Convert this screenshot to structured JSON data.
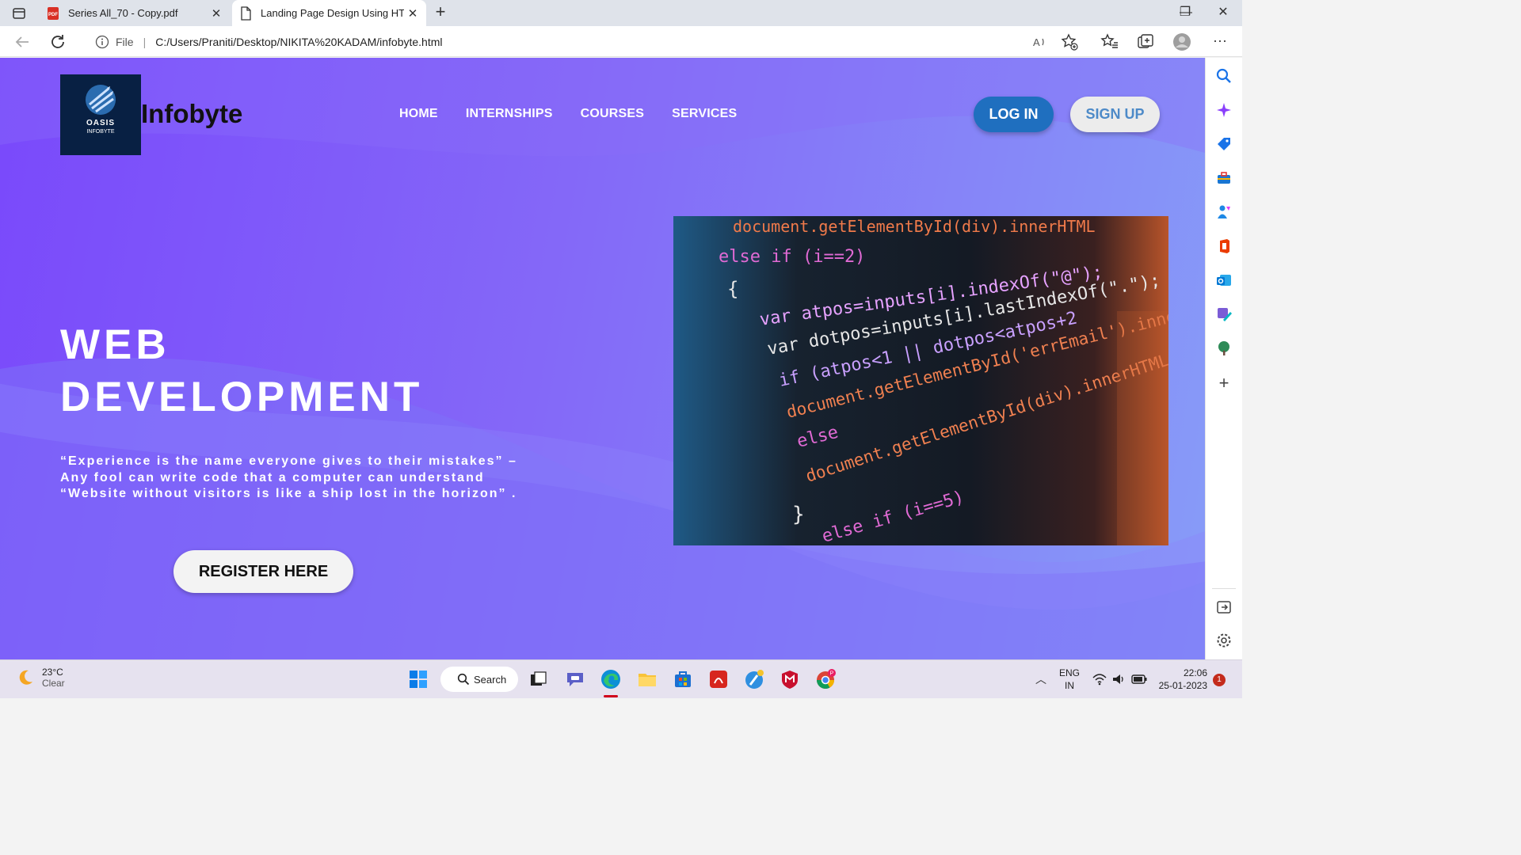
{
  "browser": {
    "tabs": [
      {
        "title": "Series All_70 - Copy.pdf",
        "icon": "pdf-icon",
        "active": false
      },
      {
        "title": "Landing Page Design Using HTM",
        "icon": "page-icon",
        "active": true
      }
    ],
    "address": {
      "scheme_label": "File",
      "url": "C:/Users/Praniti/Desktop/NIKITA%20KADAM/infobyte.html"
    }
  },
  "site": {
    "logo": {
      "line1": "OASIS",
      "line2": "INFOBYTE"
    },
    "brand": "Infobyte",
    "nav": [
      "HOME",
      "INTERNSHIPS",
      "COURSES",
      "SERVICES"
    ],
    "login_label": "LOG IN",
    "signup_label": "SIGN UP",
    "hero": {
      "title_line1": "WEB",
      "title_line2": "DEVELOPMENT",
      "quotes": [
        "“Experience is the name everyone gives to their mistakes” –",
        "Any fool can write code that a computer can understand",
        "“Website without visitors is like a ship lost in the horizon” ."
      ],
      "register_label": "REGISTER HERE"
    },
    "code_image": {
      "lines": [
        "document.getElementById(div).innerHTML",
        "else if (i==2)",
        "{",
        "var atpos=inputs[i].indexOf(\"@\");",
        "var dotpos=inputs[i].lastIndexOf(\".\");",
        "if (atpos<1 || dotpos<atpos+2",
        "document.getElementById('errEmail').innerHTML",
        "else",
        "document.getElementById(div).innerHTML",
        "}",
        "else if (i==5)"
      ]
    },
    "colors": {
      "gradient_start": "#7a49fb",
      "gradient_end": "#879cf8",
      "login_bg": "#1f6fbf",
      "signup_text": "#4d8ac8"
    }
  },
  "taskbar": {
    "weather": {
      "temp": "23°C",
      "condition": "Clear"
    },
    "search_label": "Search",
    "lang": {
      "line1": "ENG",
      "line2": "IN"
    },
    "clock": {
      "time": "22:06",
      "date": "25-01-2023"
    },
    "notification_count": "1"
  }
}
